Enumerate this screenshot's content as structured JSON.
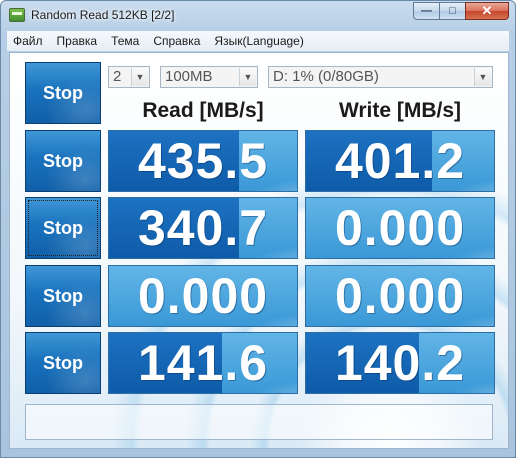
{
  "window": {
    "title": "Random Read 512KB [2/2]",
    "caption_buttons": {
      "minimize": "—",
      "maximize": "□",
      "close": "✕"
    }
  },
  "menu": [
    "Файл",
    "Правка",
    "Тема",
    "Справка",
    "Язык(Language)"
  ],
  "controls": {
    "stop_label": "Stop",
    "count_value": "2",
    "size_value": "100MB",
    "drive_value": "D: 1% (0/80GB)"
  },
  "headers": {
    "read": "Read [MB/s]",
    "write": "Write [MB/s]"
  },
  "results": [
    {
      "read": "435.5",
      "write": "401.2",
      "read_fill": 0.69,
      "write_fill": 0.67
    },
    {
      "read": "340.7",
      "write": "0.000",
      "read_fill": 0.69,
      "write_fill": 0.0
    },
    {
      "read": "0.000",
      "write": "0.000",
      "read_fill": 0.0,
      "write_fill": 0.0
    },
    {
      "read": "141.6",
      "write": "140.2",
      "read_fill": 0.6,
      "write_fill": 0.6
    }
  ],
  "status_text": "",
  "colors": {
    "accent_dark": "#0e5ba8",
    "accent_light": "#62b5e6"
  }
}
